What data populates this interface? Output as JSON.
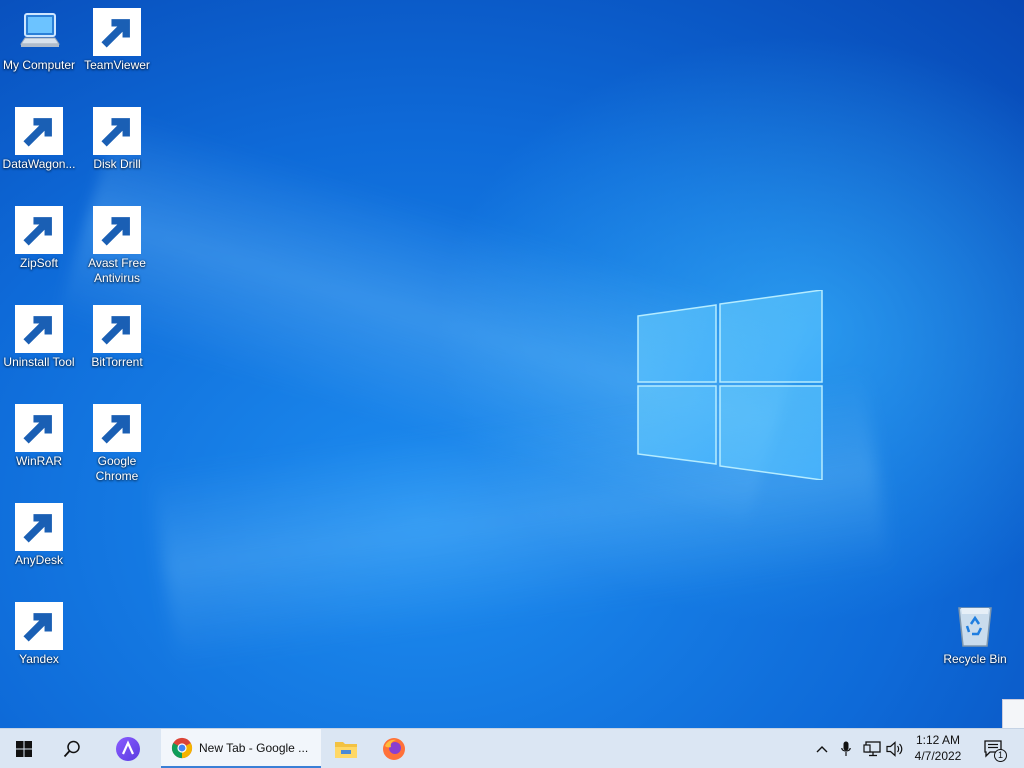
{
  "desktop": {
    "icons": [
      {
        "label": "My Computer",
        "icon": "computer-icon",
        "shortcut": false
      },
      {
        "label": "TeamViewer",
        "icon": "teamviewer-icon",
        "shortcut": true
      },
      {
        "label": "DataWagon...",
        "icon": "datawagon-icon",
        "shortcut": true
      },
      {
        "label": "Disk Drill",
        "icon": "disk-drill-icon",
        "shortcut": true
      },
      {
        "label": "ZipSoft",
        "icon": "zipsoft-icon",
        "shortcut": true
      },
      {
        "label": "Avast Free Antivirus",
        "icon": "avast-icon",
        "shortcut": true
      },
      {
        "label": "Uninstall Tool",
        "icon": "uninstall-tool-icon",
        "shortcut": true
      },
      {
        "label": "BitTorrent",
        "icon": "bittorrent-icon",
        "shortcut": true
      },
      {
        "label": "WinRAR",
        "icon": "winrar-icon",
        "shortcut": true
      },
      {
        "label": "Google Chrome",
        "icon": "chrome-icon",
        "shortcut": true
      },
      {
        "label": "AnyDesk",
        "icon": "anydesk-icon",
        "shortcut": true
      },
      {
        "label": "Yandex",
        "icon": "yandex-icon",
        "shortcut": true
      },
      {
        "label": "Recycle Bin",
        "icon": "recycle-bin-icon",
        "shortcut": false
      }
    ]
  },
  "taskbar": {
    "task": {
      "label": "New Tab - Google ...",
      "icon": "chrome-icon"
    },
    "clock": {
      "time": "1:12 AM",
      "date": "4/7/2022"
    },
    "notification_count": "1",
    "accent": "#3b7fd6"
  }
}
